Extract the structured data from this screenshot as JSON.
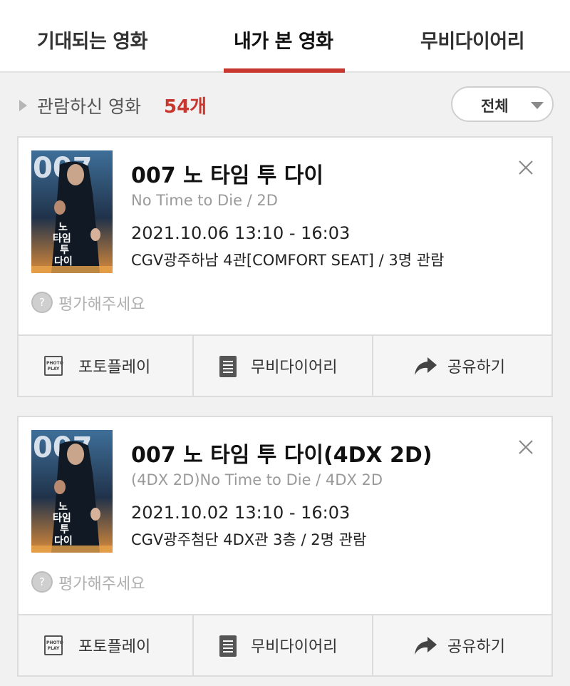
{
  "tabs": {
    "items": [
      {
        "label": "기대되는 영화"
      },
      {
        "label": "내가 본 영화"
      },
      {
        "label": "무비다이어리"
      }
    ],
    "active_color": "#c8372d"
  },
  "summary": {
    "label": "관람하신 영화",
    "count": "54개",
    "filter_label": "전체"
  },
  "movies": [
    {
      "title": "007 노 타임 투 다이",
      "subtitle": "No Time to Die / 2D",
      "datetime": "2021.10.06 13:10 - 16:03",
      "theater": "CGV광주하남 4관[COMFORT SEAT] / 3명 관람",
      "rate_label": "평가해주세요",
      "rate_icon": "?",
      "poster_title": "노\n타임\n투\n다이",
      "actions": [
        {
          "label": "포토플레이",
          "icon": "photoplay-icon",
          "icon_line1": "PHOTO",
          "icon_line2": "PLAY"
        },
        {
          "label": "무비다이어리",
          "icon": "document-icon"
        },
        {
          "label": "공유하기",
          "icon": "share-arrow-icon"
        }
      ]
    },
    {
      "title": "007 노 타임 투 다이(4DX 2D)",
      "subtitle": "(4DX 2D)No Time to Die / 4DX 2D",
      "datetime": "2021.10.02 13:10 - 16:03",
      "theater": "CGV광주첨단 4DX관 3층 / 2명 관람",
      "rate_label": "평가해주세요",
      "rate_icon": "?",
      "poster_title": "노\n타임\n투\n다이",
      "actions": [
        {
          "label": "포토플레이",
          "icon": "photoplay-icon",
          "icon_line1": "PHOTO",
          "icon_line2": "PLAY"
        },
        {
          "label": "무비다이어리",
          "icon": "document-icon"
        },
        {
          "label": "공유하기",
          "icon": "share-arrow-icon"
        }
      ]
    }
  ]
}
